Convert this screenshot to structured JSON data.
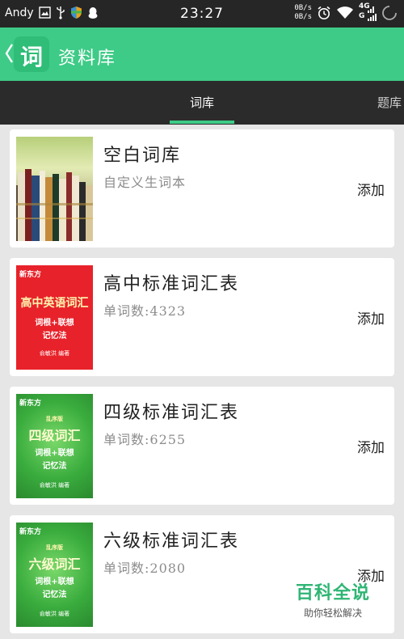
{
  "status_bar": {
    "user": "Andy",
    "time": "23:27",
    "net_up": "0B/s",
    "net_down": "0B/s",
    "network_4g": "4G",
    "network_g": "G"
  },
  "app_bar": {
    "title": "资料库",
    "logo_glyph": "词"
  },
  "tabs": [
    {
      "label": "词库",
      "active": true
    },
    {
      "label": "题库",
      "active": false
    }
  ],
  "books": [
    {
      "title": "空白词库",
      "subtitle": "自定义生词本",
      "action": "添加",
      "cover": "bookshelf"
    },
    {
      "title": "高中标准词汇表",
      "subtitle": "单词数:4323",
      "action": "添加",
      "cover": "red",
      "cover_brand": "新东方",
      "cover_title": "高中英语词汇",
      "cover_sub1": "词根+联想",
      "cover_sub2": "记忆法",
      "cover_author": "俞敏洪 编著"
    },
    {
      "title": "四级标准词汇表",
      "subtitle": "单词数:6255",
      "action": "添加",
      "cover": "green",
      "cover_brand": "新东方",
      "cover_tag": "乱序版",
      "cover_title": "四级词汇",
      "cover_sub1": "词根+联想",
      "cover_sub2": "记忆法",
      "cover_author": "俞敏洪 编著"
    },
    {
      "title": "六级标准词汇表",
      "subtitle": "单词数:2080",
      "action": "添加",
      "cover": "green",
      "cover_brand": "新东方",
      "cover_tag": "乱序版",
      "cover_title": "六级词汇",
      "cover_sub1": "词根+联想",
      "cover_sub2": "记忆法",
      "cover_author": "俞敏洪 编著"
    }
  ],
  "watermark": {
    "title": "百科全说",
    "subtitle": "助你轻松解决"
  },
  "colors": {
    "accent": "#3ecb87",
    "status_bar": "#262626",
    "tab_bar": "#2b2b2b",
    "red_cover": "#e8222a",
    "green_cover": "#3aad3e"
  }
}
